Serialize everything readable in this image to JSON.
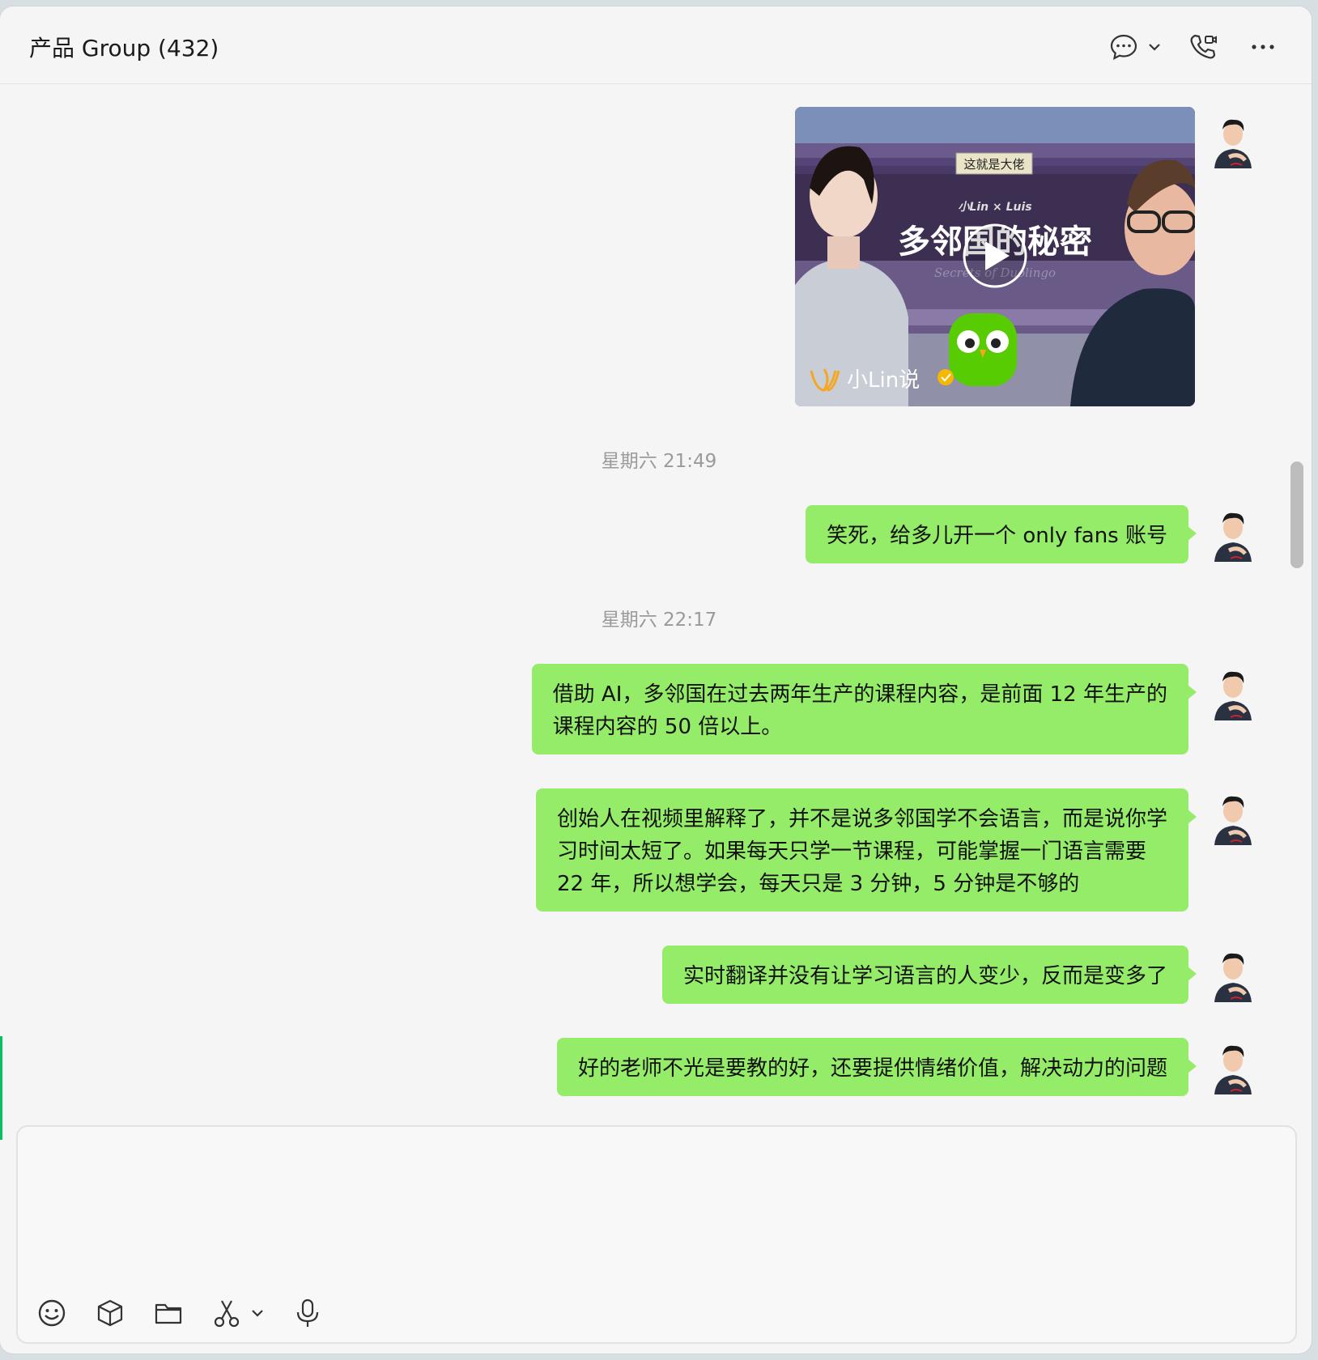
{
  "header": {
    "title": "产品 Group (432)",
    "icons": [
      "chat-bubble-icon",
      "chevron-down-icon",
      "phone-video-icon",
      "more-icon"
    ]
  },
  "video": {
    "badge": "这就是大佬",
    "hosts": "小Lin × Luis",
    "title": "多邻国的秘密",
    "subtitle": "Secrets of Duolingo",
    "channel": "小Lin说"
  },
  "messages": [
    {
      "type": "time",
      "text": "星期六 21:49"
    },
    {
      "type": "text",
      "text": "笑死，给多儿开一个 only fans 账号"
    },
    {
      "type": "time",
      "text": "星期六 22:17"
    },
    {
      "type": "text",
      "lines": [
        "借助 AI，多邻国在过去两年生产的课程内容，是前面 12 年生产的",
        "课程内容的 50 倍以上。"
      ]
    },
    {
      "type": "text",
      "lines": [
        "创始人在视频里解释了，并不是说多邻国学不会语言，而是说你学",
        "习时间太短了。如果每天只学一节课程，可能掌握一门语言需要",
        "22 年，所以想学会，每天只是 3 分钟，5 分钟是不够的"
      ]
    },
    {
      "type": "text",
      "text": "实时翻译并没有让学习语言的人变少，反而是变多了"
    },
    {
      "type": "text",
      "text": "好的老师不光是要教的好，还要提供情绪价值，解决动力的问题"
    }
  ],
  "toolbar": {
    "icons": [
      "emoji-icon",
      "sticker-box-icon",
      "folder-icon",
      "scissors-icon",
      "chevron-down-icon",
      "microphone-icon"
    ]
  }
}
